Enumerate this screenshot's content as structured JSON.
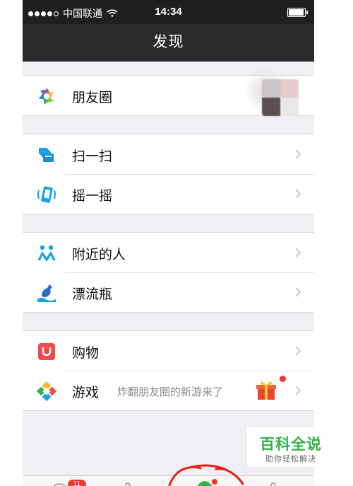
{
  "status_bar": {
    "carrier": "中国联通",
    "time": "14:34",
    "signal_dots_filled": 4,
    "signal_dots_total": 5,
    "battery_level": 0.9
  },
  "nav": {
    "title": "发现"
  },
  "groups": [
    {
      "items": [
        {
          "label": "朋友圈",
          "icon": "moments-icon"
        }
      ]
    },
    {
      "items": [
        {
          "label": "扫一扫",
          "icon": "scan-icon"
        },
        {
          "label": "摇一摇",
          "icon": "shake-icon"
        }
      ]
    },
    {
      "items": [
        {
          "label": "附近的人",
          "icon": "people-nearby-icon"
        },
        {
          "label": "漂流瓶",
          "icon": "drift-bottle-icon"
        }
      ]
    },
    {
      "items": [
        {
          "label": "购物",
          "icon": "shopping-icon"
        },
        {
          "label": "游戏",
          "icon": "games-icon",
          "description": "炸翻朋友圈的新游来了"
        }
      ]
    }
  ],
  "tab_bar": {
    "chats_badge": "11"
  },
  "watermark": {
    "brand": "百科全说",
    "subtitle": "助你轻松解决"
  },
  "colors": {
    "nav_background": "#2b2b2e",
    "page_background": "#efeff4",
    "badge_red": "#f43530",
    "brand_green": "#36b14a",
    "scan_blue": "#1aa1e6"
  }
}
